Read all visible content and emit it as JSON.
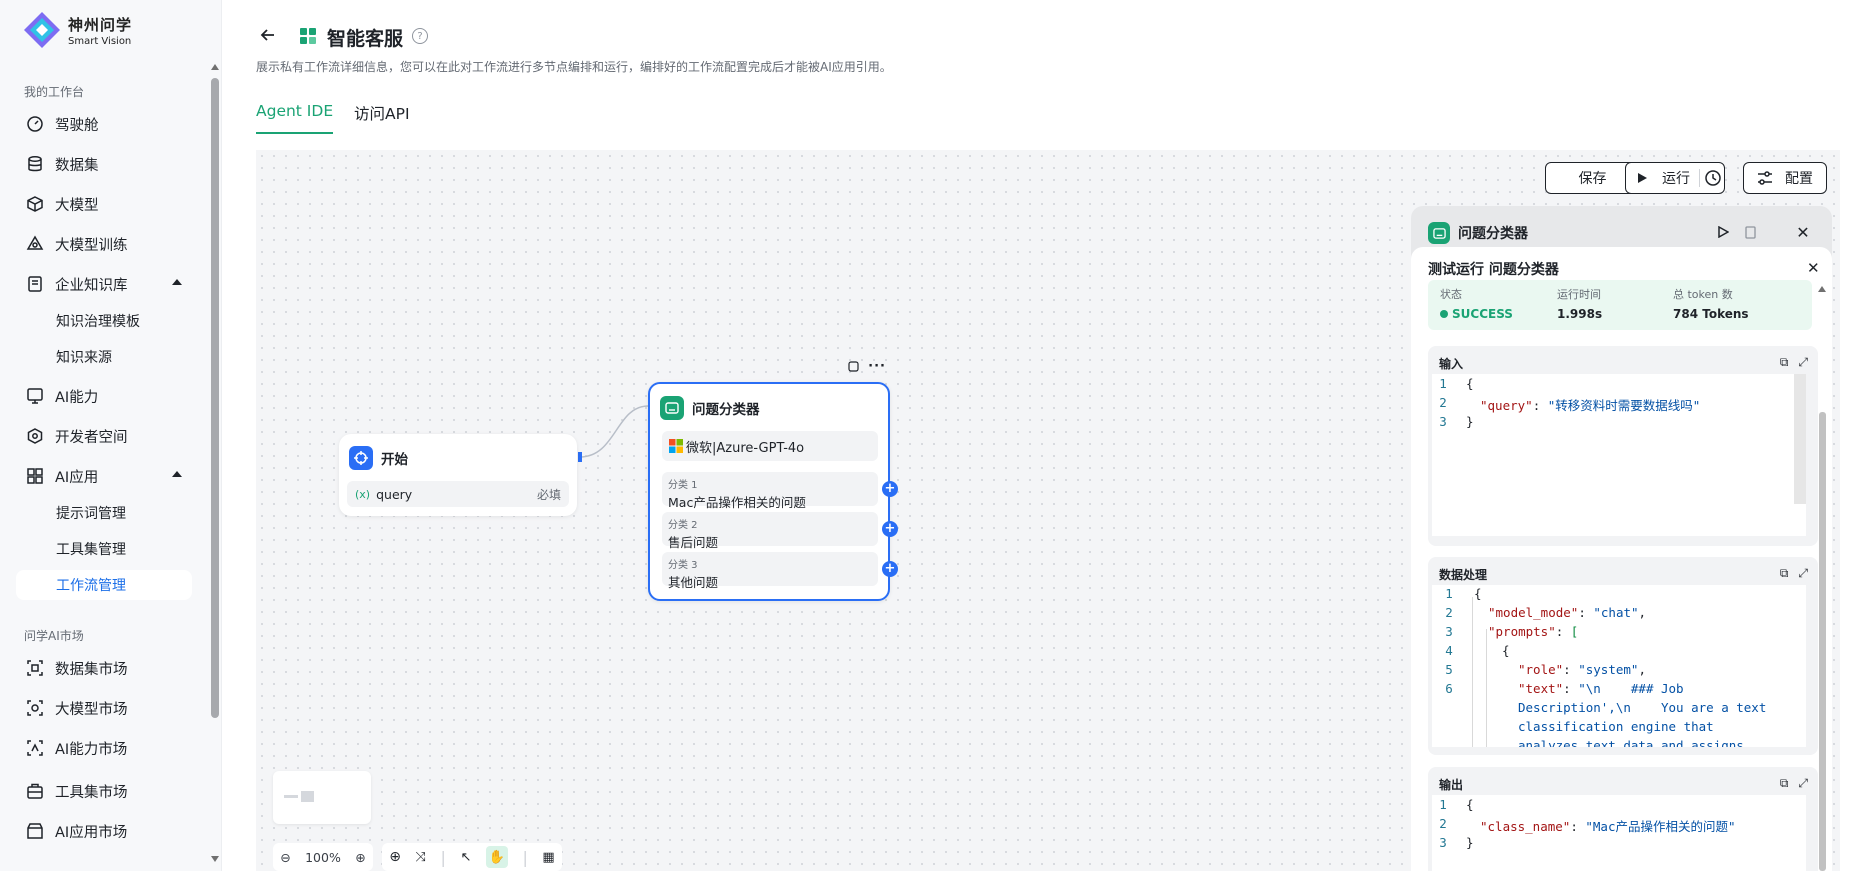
{
  "brand": {
    "name_cn": "神州问学",
    "name_en": "Smart Vision"
  },
  "sidebar": {
    "section_workspace": "我的工作台",
    "items": [
      {
        "label": "驾驶舱",
        "icon": "dashboard-icon"
      },
      {
        "label": "数据集",
        "icon": "database-icon"
      },
      {
        "label": "大模型",
        "icon": "cube-icon"
      },
      {
        "label": "大模型训练",
        "icon": "training-icon"
      },
      {
        "label": "企业知识库",
        "icon": "knowledge-icon"
      },
      {
        "label": "知识治理模板"
      },
      {
        "label": "知识来源"
      },
      {
        "label": "AI能力",
        "icon": "ai-capability-icon"
      },
      {
        "label": "开发者空间",
        "icon": "developer-icon"
      },
      {
        "label": "AI应用",
        "icon": "grid-icon"
      },
      {
        "label": "提示词管理"
      },
      {
        "label": "工具集管理"
      },
      {
        "label": "工作流管理"
      }
    ],
    "section_market": "问学AI市场",
    "market_items": [
      {
        "label": "数据集市场",
        "icon": "dataset-market-icon"
      },
      {
        "label": "大模型市场",
        "icon": "model-market-icon"
      },
      {
        "label": "AI能力市场",
        "icon": "ai-market-icon"
      },
      {
        "label": "工具集市场",
        "icon": "toolbox-icon"
      },
      {
        "label": "AI应用市场",
        "icon": "app-market-icon"
      }
    ]
  },
  "header": {
    "title": "智能客服",
    "description": "展示私有工作流详细信息，您可以在此对工作流进行多节点编排和运行，编排好的工作流配置完成后才能被AI应用引用。",
    "tabs": [
      "Agent IDE",
      "访问API"
    ],
    "active_tab": "Agent IDE"
  },
  "toolbar": {
    "save": "保存",
    "run": "运行",
    "config": "配置"
  },
  "nodes": {
    "start": {
      "title": "开始",
      "param_icon": "(x)",
      "param": "query",
      "required": "必填"
    },
    "classifier": {
      "title": "问题分类器",
      "model": "微软|Azure-GPT-4o",
      "classes": [
        {
          "label": "分类 1",
          "value": "Mac产品操作相关的问题"
        },
        {
          "label": "分类 2",
          "value": "售后问题"
        },
        {
          "label": "分类 3",
          "value": "其他问题"
        }
      ]
    }
  },
  "zoom": {
    "level": "100%"
  },
  "panel": {
    "title": "问题分类器",
    "test_title": "测试运行 问题分类器",
    "status": {
      "status_label": "状态",
      "status_value": "SUCCESS",
      "time_label": "运行时间",
      "time_value": "1.998s",
      "token_label": "总 token 数",
      "token_value": "784 Tokens"
    },
    "input": {
      "title": "输入",
      "lines": [
        "{",
        "\"query\"",
        ": ",
        "\"转移资料时需要数据线吗\"",
        "}"
      ]
    },
    "processing": {
      "title": "数据处理",
      "l1": "{",
      "l2k": "\"model_mode\"",
      "l2v": "\"chat\"",
      "l3k": "\"prompts\"",
      "l3v": "[",
      "l4": "{",
      "l5k": "\"role\"",
      "l5v": "\"system\"",
      "l6k": "\"text\"",
      "l6v": "\"\\n    ### Job",
      "l6b": "Description',\\n    You are a text",
      "l6c": "classification engine that",
      "l6d": "analyzes text data and assigns"
    },
    "output": {
      "title": "输出",
      "k": "\"class_name\"",
      "v": "\"Mac产品操作相关的问题\""
    }
  },
  "colors": {
    "accent": "#1aa374",
    "node_border": "#2a6ef5",
    "active_nav": "#1c6fe8"
  }
}
